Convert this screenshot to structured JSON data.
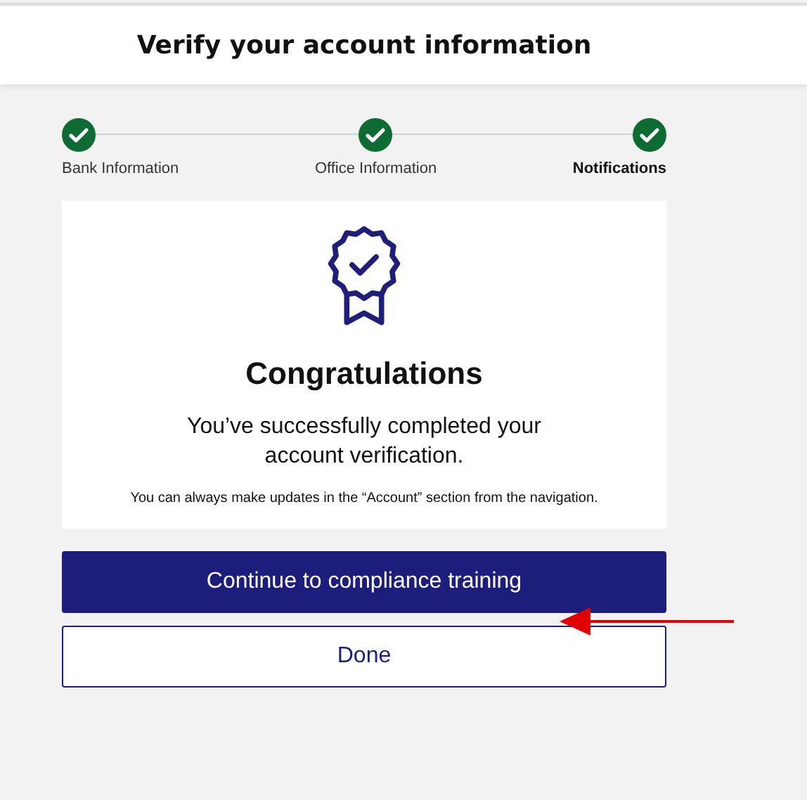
{
  "header": {
    "title": "Verify your account information"
  },
  "steps": [
    {
      "label": "Bank Information",
      "done": true,
      "selected": false
    },
    {
      "label": "Office Information",
      "done": true,
      "selected": false
    },
    {
      "label": "Notifications",
      "done": true,
      "selected": true
    }
  ],
  "card": {
    "heading": "Congratulations",
    "message": "You’ve successfully completed your account verification.",
    "note": "You can always make updates in the “Account” section from the navigation."
  },
  "buttons": [
    {
      "label": "Continue to compliance training",
      "kind": "primary"
    },
    {
      "label": "Done",
      "kind": "secondary"
    }
  ],
  "annotation": {
    "kind": "arrow"
  }
}
